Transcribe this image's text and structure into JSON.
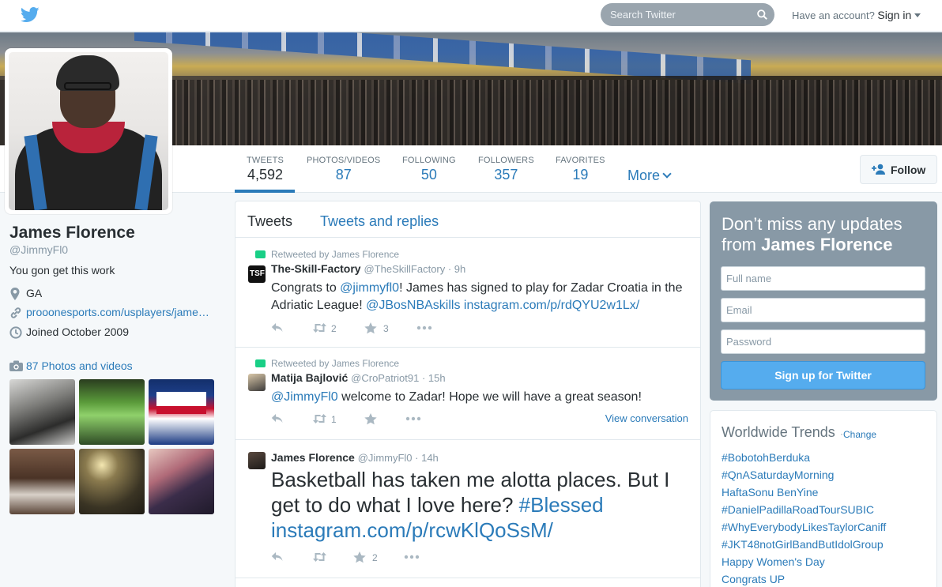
{
  "topbar": {
    "search_placeholder": "Search Twitter",
    "account_prompt": "Have an account?",
    "sign_in": "Sign in"
  },
  "profile": {
    "name": "James Florence",
    "handle": "@JimmyFl0",
    "bio": "You gon get this work",
    "location": "GA",
    "website": "prooonesports.com/usplayers/jame…",
    "joined": "Joined October 2009",
    "photos_link": "87 Photos and videos"
  },
  "stats": [
    {
      "label": "TWEETS",
      "value": "4,592"
    },
    {
      "label": "PHOTOS/VIDEOS",
      "value": "87"
    },
    {
      "label": "FOLLOWING",
      "value": "50"
    },
    {
      "label": "FOLLOWERS",
      "value": "357"
    },
    {
      "label": "FAVORITES",
      "value": "19"
    }
  ],
  "nav": {
    "more": "More",
    "follow": "Follow"
  },
  "timeline": {
    "tab_tweets": "Tweets",
    "tab_replies": "Tweets and replies",
    "tweets": [
      {
        "retweeted_by": "Retweeted by James Florence",
        "author": "The-Skill-Factory",
        "screen_name": "@TheSkillFactory · 9h",
        "text_1": "Congrats to ",
        "mention_1": "@jimmyfl0",
        "text_2": "! James has signed to play for Zadar Croatia in the Adriatic League! ",
        "mention_2": "@JBosNBAskills",
        "link": " instagram.com/p/rdQYU2w1Lx/",
        "retweets": "2",
        "favorites": "3"
      },
      {
        "retweeted_by": "Retweeted by James Florence",
        "author": "Matija Bajlović",
        "screen_name": "@CroPatriot91 · 15h",
        "mention_1": "@JimmyFl0",
        "text_1": " welcome to Zadar! Hope we will have a great season!",
        "retweets": "1",
        "view_conversation": "View conversation"
      },
      {
        "author": "James Florence",
        "screen_name": "@JimmyFl0 · 14h",
        "text_1": "Basketball has taken me alotta places. But I get to do what I love here? ",
        "hashtag": "#Blessed",
        "link": "instagram.com/p/rcwKlQoSsM/",
        "favorites": "2"
      }
    ]
  },
  "signup": {
    "title_1": "Don’t miss any updates from ",
    "title_name": "James Florence",
    "fullname_placeholder": "Full name",
    "email_placeholder": "Email",
    "password_placeholder": "Password",
    "button": "Sign up for Twitter"
  },
  "trends": {
    "title": "Worldwide Trends",
    "dot": "·",
    "change": "Change",
    "items": [
      "#BobotohBerduka",
      "#QnASaturdayMorning",
      "HaftaSonu BenYine",
      "#DanielPadillaRoadTourSUBIC",
      "#WhyEverybodyLikesTaylorCaniff",
      "#JKT48notGirlBandButIdolGroup",
      "Happy Women's Day",
      "Congrats UP"
    ]
  },
  "colors": {
    "accent": "#2b7bb9",
    "signup_bg": "#8899a6",
    "signup_button": "#55acee",
    "retweet_green": "#19cf86"
  }
}
